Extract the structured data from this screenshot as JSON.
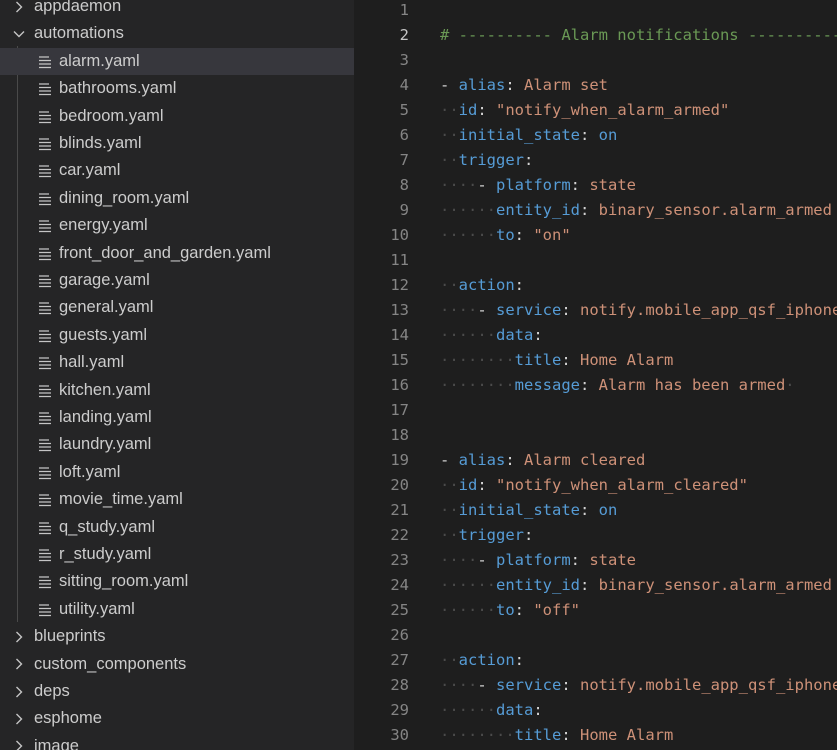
{
  "explorer": {
    "top_folders": [
      {
        "label": "appdaemon",
        "expanded": false
      },
      {
        "label": "automations",
        "expanded": true
      }
    ],
    "files": [
      {
        "label": "alarm.yaml",
        "selected": true
      },
      {
        "label": "bathrooms.yaml"
      },
      {
        "label": "bedroom.yaml"
      },
      {
        "label": "blinds.yaml"
      },
      {
        "label": "car.yaml"
      },
      {
        "label": "dining_room.yaml"
      },
      {
        "label": "energy.yaml"
      },
      {
        "label": "front_door_and_garden.yaml"
      },
      {
        "label": "garage.yaml"
      },
      {
        "label": "general.yaml"
      },
      {
        "label": "guests.yaml"
      },
      {
        "label": "hall.yaml"
      },
      {
        "label": "kitchen.yaml"
      },
      {
        "label": "landing.yaml"
      },
      {
        "label": "laundry.yaml"
      },
      {
        "label": "loft.yaml"
      },
      {
        "label": "movie_time.yaml"
      },
      {
        "label": "q_study.yaml"
      },
      {
        "label": "r_study.yaml"
      },
      {
        "label": "sitting_room.yaml"
      },
      {
        "label": "utility.yaml"
      }
    ],
    "bottom_folders": [
      {
        "label": "blueprints",
        "expanded": false
      },
      {
        "label": "custom_components",
        "expanded": false
      },
      {
        "label": "deps",
        "expanded": false
      },
      {
        "label": "esphome",
        "expanded": false
      },
      {
        "label": "image",
        "expanded": false
      }
    ],
    "icons": {
      "collapsed": "chevron-right-icon",
      "expanded": "chevron-down-icon",
      "file": "file-lines-icon"
    }
  },
  "editor": {
    "active_line": 2,
    "colors": {
      "keyword": "#569cd6",
      "string": "#ce9178",
      "comment": "#6a9955",
      "punct": "#d4d4d4",
      "whitespace": "#4b4b4b"
    },
    "lines": [
      {
        "n": "1",
        "tokens": []
      },
      {
        "n": "2",
        "tokens": [
          [
            "c",
            "# ---------- Alarm notifications ----------------"
          ]
        ]
      },
      {
        "n": "3",
        "tokens": []
      },
      {
        "n": "4",
        "tokens": [
          [
            "p",
            "- "
          ],
          [
            "k",
            "alias"
          ],
          [
            "p",
            ": "
          ],
          [
            "s",
            "Alarm set"
          ]
        ]
      },
      {
        "n": "5",
        "tokens": [
          [
            "w",
            "··"
          ],
          [
            "k",
            "id"
          ],
          [
            "p",
            ": "
          ],
          [
            "s",
            "\"notify_when_alarm_armed\""
          ]
        ]
      },
      {
        "n": "6",
        "tokens": [
          [
            "w",
            "··"
          ],
          [
            "k",
            "initial_state"
          ],
          [
            "p",
            ": "
          ],
          [
            "k",
            "on"
          ]
        ]
      },
      {
        "n": "7",
        "tokens": [
          [
            "w",
            "··"
          ],
          [
            "k",
            "trigger"
          ],
          [
            "p",
            ":"
          ]
        ]
      },
      {
        "n": "8",
        "tokens": [
          [
            "w",
            "····"
          ],
          [
            "p",
            "- "
          ],
          [
            "k",
            "platform"
          ],
          [
            "p",
            ": "
          ],
          [
            "s",
            "state"
          ]
        ]
      },
      {
        "n": "9",
        "tokens": [
          [
            "w",
            "····"
          ],
          [
            "w",
            "··"
          ],
          [
            "k",
            "entity_id"
          ],
          [
            "p",
            ": "
          ],
          [
            "s",
            "binary_sensor.alarm_armed"
          ]
        ]
      },
      {
        "n": "10",
        "tokens": [
          [
            "w",
            "······"
          ],
          [
            "k",
            "to"
          ],
          [
            "p",
            ": "
          ],
          [
            "s",
            "\"on\""
          ]
        ]
      },
      {
        "n": "11",
        "tokens": []
      },
      {
        "n": "12",
        "tokens": [
          [
            "w",
            "··"
          ],
          [
            "k",
            "action"
          ],
          [
            "p",
            ":"
          ]
        ]
      },
      {
        "n": "13",
        "tokens": [
          [
            "w",
            "····"
          ],
          [
            "p",
            "- "
          ],
          [
            "k",
            "service"
          ],
          [
            "p",
            ": "
          ],
          [
            "s",
            "notify.mobile_app_qsf_iphone"
          ]
        ]
      },
      {
        "n": "14",
        "tokens": [
          [
            "w",
            "······"
          ],
          [
            "k",
            "data"
          ],
          [
            "p",
            ":"
          ]
        ]
      },
      {
        "n": "15",
        "tokens": [
          [
            "w",
            "········"
          ],
          [
            "k",
            "title"
          ],
          [
            "p",
            ": "
          ],
          [
            "s",
            "Home Alarm"
          ]
        ]
      },
      {
        "n": "16",
        "tokens": [
          [
            "w",
            "········"
          ],
          [
            "k",
            "message"
          ],
          [
            "p",
            ": "
          ],
          [
            "s",
            "Alarm has been armed"
          ],
          [
            "w",
            "·"
          ]
        ]
      },
      {
        "n": "17",
        "tokens": []
      },
      {
        "n": "18",
        "tokens": []
      },
      {
        "n": "19",
        "tokens": [
          [
            "p",
            "- "
          ],
          [
            "k",
            "alias"
          ],
          [
            "p",
            ": "
          ],
          [
            "s",
            "Alarm cleared"
          ]
        ]
      },
      {
        "n": "20",
        "tokens": [
          [
            "w",
            "··"
          ],
          [
            "k",
            "id"
          ],
          [
            "p",
            ": "
          ],
          [
            "s",
            "\"notify_when_alarm_cleared\""
          ]
        ]
      },
      {
        "n": "21",
        "tokens": [
          [
            "w",
            "··"
          ],
          [
            "k",
            "initial_state"
          ],
          [
            "p",
            ": "
          ],
          [
            "k",
            "on"
          ]
        ]
      },
      {
        "n": "22",
        "tokens": [
          [
            "w",
            "··"
          ],
          [
            "k",
            "trigger"
          ],
          [
            "p",
            ":"
          ]
        ]
      },
      {
        "n": "23",
        "tokens": [
          [
            "w",
            "····"
          ],
          [
            "p",
            "- "
          ],
          [
            "k",
            "platform"
          ],
          [
            "p",
            ": "
          ],
          [
            "s",
            "state"
          ]
        ]
      },
      {
        "n": "24",
        "tokens": [
          [
            "w",
            "······"
          ],
          [
            "k",
            "entity_id"
          ],
          [
            "p",
            ": "
          ],
          [
            "s",
            "binary_sensor.alarm_armed"
          ]
        ]
      },
      {
        "n": "25",
        "tokens": [
          [
            "w",
            "······"
          ],
          [
            "k",
            "to"
          ],
          [
            "p",
            ": "
          ],
          [
            "s",
            "\"off\""
          ]
        ]
      },
      {
        "n": "26",
        "tokens": []
      },
      {
        "n": "27",
        "tokens": [
          [
            "w",
            "··"
          ],
          [
            "k",
            "action"
          ],
          [
            "p",
            ":"
          ]
        ]
      },
      {
        "n": "28",
        "tokens": [
          [
            "w",
            "····"
          ],
          [
            "p",
            "- "
          ],
          [
            "k",
            "service"
          ],
          [
            "p",
            ": "
          ],
          [
            "s",
            "notify.mobile_app_qsf_iphone"
          ]
        ]
      },
      {
        "n": "29",
        "tokens": [
          [
            "w",
            "······"
          ],
          [
            "k",
            "data"
          ],
          [
            "p",
            ":"
          ]
        ]
      },
      {
        "n": "30",
        "tokens": [
          [
            "w",
            "········"
          ],
          [
            "k",
            "title"
          ],
          [
            "p",
            ": "
          ],
          [
            "s",
            "Home Alarm"
          ]
        ]
      }
    ]
  }
}
